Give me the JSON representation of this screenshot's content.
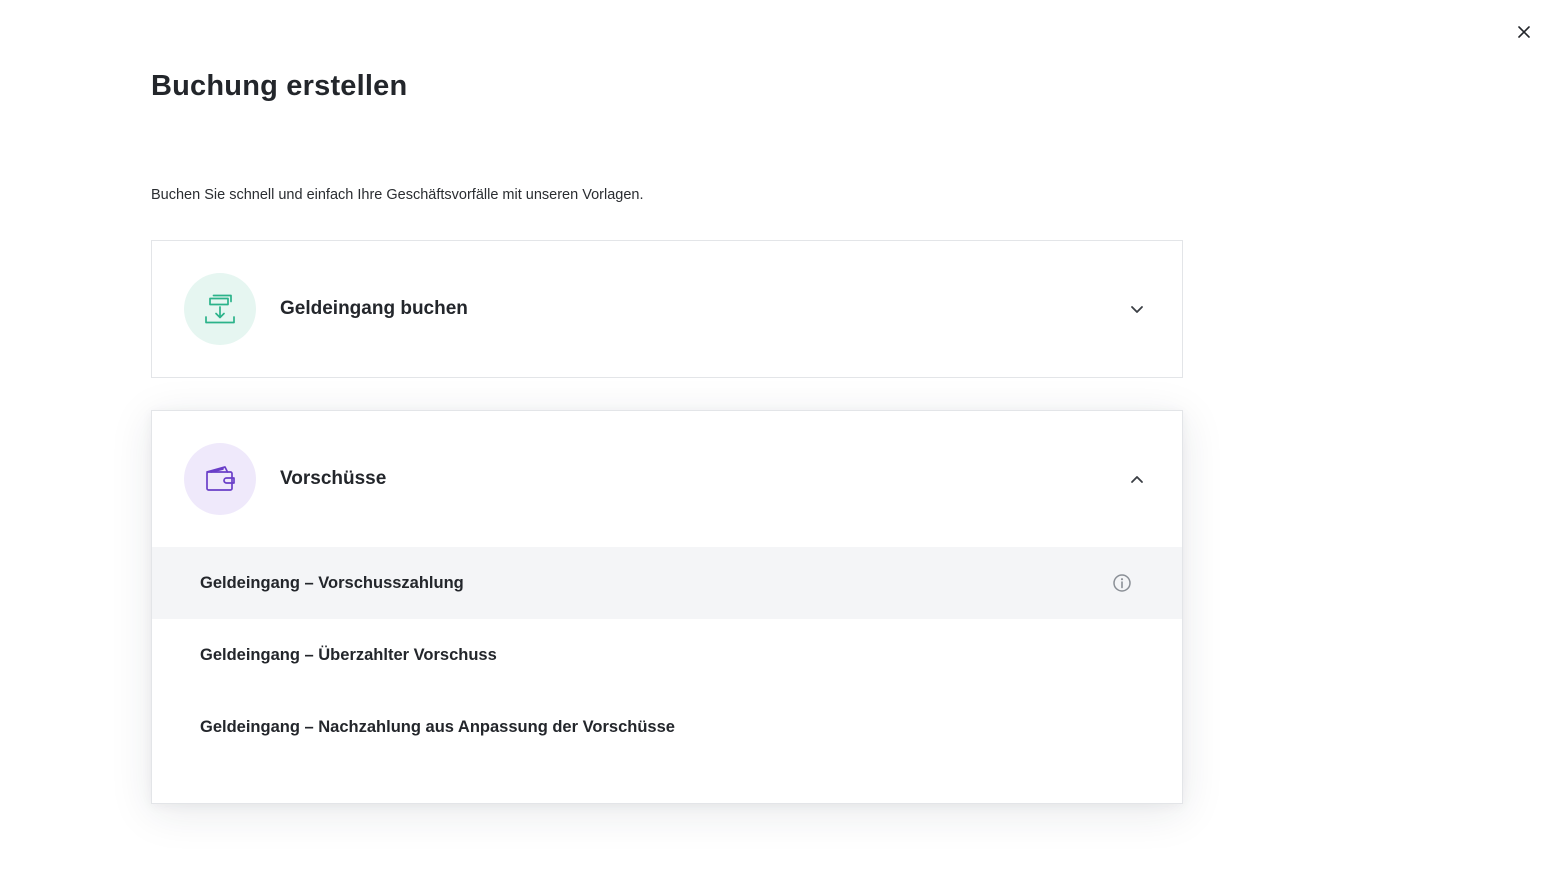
{
  "dialog": {
    "title": "Buchung erstellen",
    "intro": "Buchen Sie schnell und einfach Ihre Geschäftsvorfälle mit unseren Vorlagen.",
    "close_icon": "close-icon"
  },
  "sections": [
    {
      "title": "Geldeingang buchen",
      "icon": "money-in-icon",
      "icon_color": "#2bb38a",
      "icon_bg": "#e6f6f1",
      "expanded": false,
      "chevron": "chevron-down-icon"
    },
    {
      "title": "Vorschüsse",
      "icon": "wallet-icon",
      "icon_color": "#6a3fc8",
      "icon_bg": "#efe9fb",
      "expanded": true,
      "chevron": "chevron-up-icon",
      "items": [
        {
          "label": "Geldeingang – Vorschusszahlung",
          "info_icon": "info-icon"
        },
        {
          "label": "Geldeingang – Überzahlter Vorschuss"
        },
        {
          "label": "Geldeingang – Nachzahlung aus Anpassung der Vorschüsse"
        }
      ]
    }
  ]
}
